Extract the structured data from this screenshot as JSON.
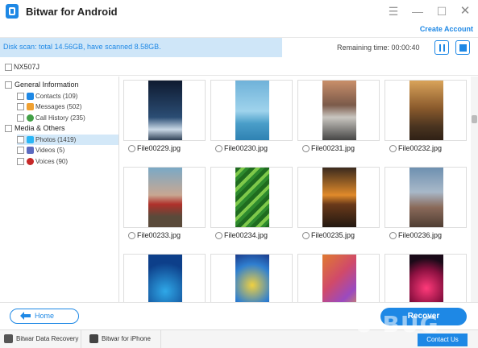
{
  "window": {
    "title": "Bitwar for Android",
    "create_account": "Create Account"
  },
  "scan": {
    "status_text": "Disk scan: total 14.56GB, have scanned 8.58GB.",
    "remaining_time": "Remaining time: 00:00:40",
    "progress_fraction": 0.59
  },
  "device": {
    "name": "NX507J"
  },
  "sidebar": {
    "general_label": "General Information",
    "general_items": [
      "Contacts (109)",
      "Messages (502)",
      "Call History (235)"
    ],
    "media_label": "Media & Others",
    "media_items": [
      "Photos (1419)",
      "Videos (5)",
      "Voices (90)"
    ],
    "selected": "Photos (1419)"
  },
  "photos": [
    "File00229.jpg",
    "File00230.jpg",
    "File00231.jpg",
    "File00232.jpg",
    "File00233.jpg",
    "File00234.jpg",
    "File00235.jpg",
    "File00236.jpg"
  ],
  "bottom": {
    "home_label": "Home",
    "recover_label": "Recover"
  },
  "footer": {
    "tab_recovery": "Bitwar Data Recovery",
    "tab_iphone": "Bitwar for iPhone",
    "contact_label": "Contact Us"
  },
  "watermark": "U BUG",
  "colors": {
    "accent": "#1e88e5",
    "selected_row": "#d3e8f8",
    "progress_fill": "#cfe6f8"
  }
}
